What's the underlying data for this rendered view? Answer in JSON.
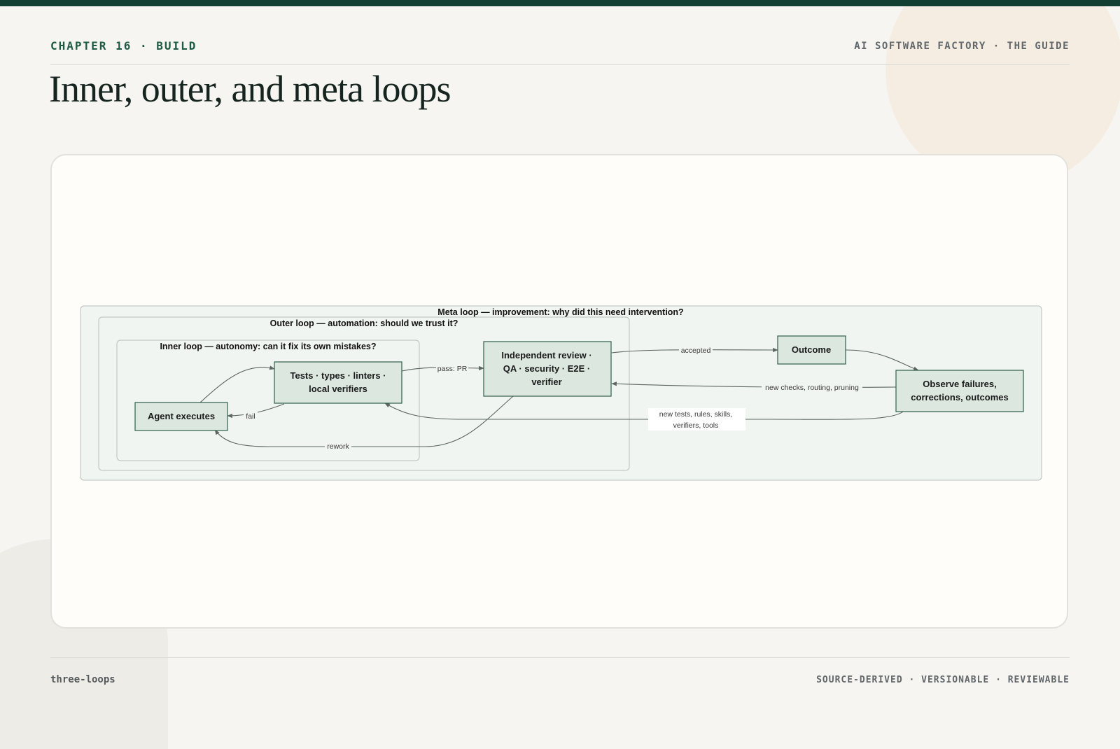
{
  "header": {
    "chapter": "CHAPTER 16 · BUILD",
    "guide": "AI SOFTWARE FACTORY · THE GUIDE"
  },
  "title": "Inner, outer, and meta loops",
  "diagram": {
    "groups": {
      "meta": "Meta loop — improvement: why did this need intervention?",
      "outer": "Outer loop — automation: should we trust it?",
      "inner": "Inner loop — autonomy: can it fix its own mistakes?"
    },
    "nodes": {
      "agent": [
        "Agent executes"
      ],
      "tests": [
        "Tests · types · linters ·",
        "local verifiers"
      ],
      "review": [
        "Independent review ·",
        "QA · security · E2E ·",
        "verifier"
      ],
      "outcome": [
        "Outcome"
      ],
      "observe": [
        "Observe failures,",
        "corrections, outcomes"
      ]
    },
    "edges": {
      "fail": "fail",
      "pass": "pass: PR",
      "rework": "rework",
      "accepted": "accepted",
      "new_checks": "new checks, routing, pruning",
      "new_tests": [
        "new tests, rules, skills,",
        "verifiers, tools"
      ]
    }
  },
  "footer": {
    "slug": "three-loops",
    "tagline": "SOURCE-DERIVED · VERSIONABLE · REVIEWABLE"
  }
}
